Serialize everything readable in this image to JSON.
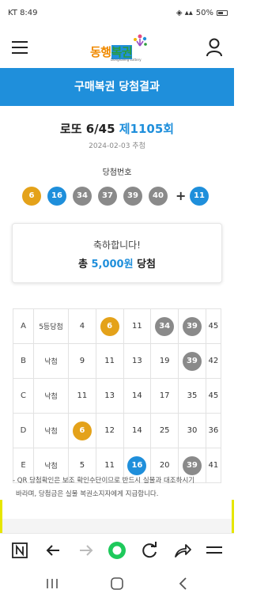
{
  "status_bar": {
    "carrier_time": "KT 8:49",
    "battery": "50%"
  },
  "header": {
    "logo_text_a": "동행",
    "logo_text_b": "복권",
    "logo_sub": "Donghaeng Lottery"
  },
  "title": "구매복권 당첨결과",
  "result": {
    "game": "로또 6/45",
    "round": "제1105회",
    "date": "2024-02-03 추첨",
    "winning_label": "당첨번호",
    "numbers": [
      6,
      16,
      34,
      37,
      39,
      40
    ],
    "plus": "+",
    "bonus": 11,
    "colors": {
      "yellow": "#e4a21a",
      "blue": "#1f8fdb",
      "gray": "#8a8a8a"
    }
  },
  "congrats": {
    "message": "축하합니다!",
    "prefix": "총",
    "amount": "5,000원",
    "suffix": "당첨"
  },
  "ticket": {
    "rows": [
      {
        "label": "A",
        "status": "5등당첨",
        "nums": [
          "4",
          "6",
          "11",
          "34",
          "39",
          "45"
        ]
      },
      {
        "label": "B",
        "status": "낙첨",
        "nums": [
          "9",
          "11",
          "13",
          "19",
          "39",
          "42"
        ]
      },
      {
        "label": "C",
        "status": "낙첨",
        "nums": [
          "11",
          "13",
          "14",
          "17",
          "35",
          "45"
        ]
      },
      {
        "label": "D",
        "status": "낙첨",
        "nums": [
          "6",
          "12",
          "14",
          "25",
          "30",
          "36"
        ]
      },
      {
        "label": "E",
        "status": "낙첨",
        "nums": [
          "5",
          "11",
          "16",
          "20",
          "39",
          "41"
        ]
      }
    ],
    "note_line1": "- QR 당첨확인은 보조 확인수단이므로 반드시 실물과 대조하시기",
    "note_line2": "바라며, 당첨금은 실물 복권소지자에게 지급합니다."
  },
  "toolbar_icons": [
    "naver-n-icon",
    "back-arrow-icon",
    "forward-arrow-icon",
    "home-circle-icon",
    "refresh-icon",
    "share-icon",
    "menu-icon"
  ],
  "sysnav_icons": [
    "recent-apps-icon",
    "home-icon",
    "back-icon"
  ]
}
